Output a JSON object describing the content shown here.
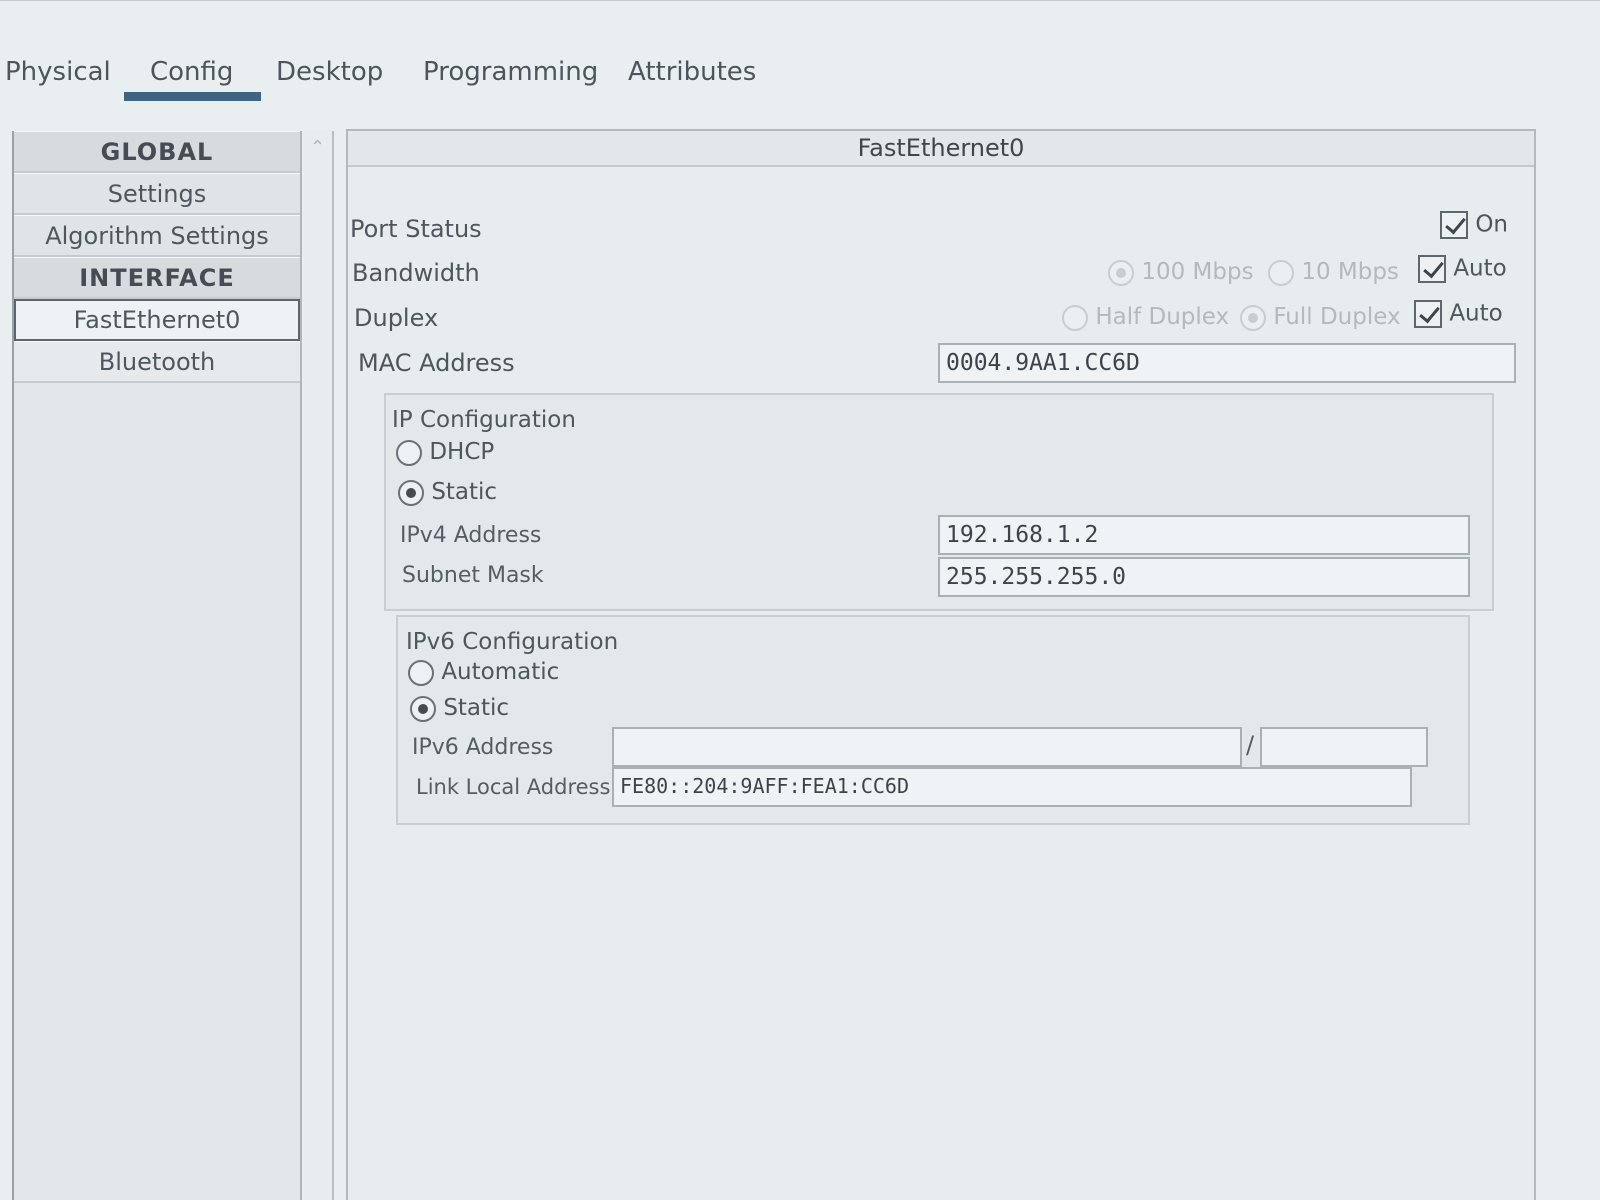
{
  "tabs": [
    {
      "label": "Physical"
    },
    {
      "label": "Config"
    },
    {
      "label": "Desktop"
    },
    {
      "label": "Programming"
    },
    {
      "label": "Attributes"
    }
  ],
  "nav": {
    "global": "GLOBAL",
    "settings": "Settings",
    "algorithm": "Algorithm Settings",
    "interface": "INTERFACE",
    "fastethernet": "FastEthernet0",
    "bluetooth": "Bluetooth"
  },
  "panel": {
    "title": "FastEthernet0",
    "port_status": {
      "label": "Port Status",
      "on_label": "On",
      "on": true
    },
    "bandwidth": {
      "label": "Bandwidth",
      "opt1": "100 Mbps",
      "opt2": "10 Mbps",
      "auto": "Auto"
    },
    "duplex": {
      "label": "Duplex",
      "opt1": "Half Duplex",
      "opt2": "Full Duplex",
      "auto": "Auto"
    },
    "mac": {
      "label": "MAC Address",
      "value": "0004.9AA1.CC6D"
    },
    "ipv4": {
      "title": "IP Configuration",
      "dhcp": "DHCP",
      "static": "Static",
      "address_label": "IPv4 Address",
      "address": "192.168.1.2",
      "mask_label": "Subnet Mask",
      "mask": "255.255.255.0"
    },
    "ipv6": {
      "title": "IPv6 Configuration",
      "automatic": "Automatic",
      "static": "Static",
      "address_label": "IPv6 Address",
      "address": "",
      "prefix": "",
      "separator": "/",
      "link_local_label": "Link Local Address:",
      "link_local": "FE80::204:9AFF:FEA1:CC6D"
    }
  }
}
